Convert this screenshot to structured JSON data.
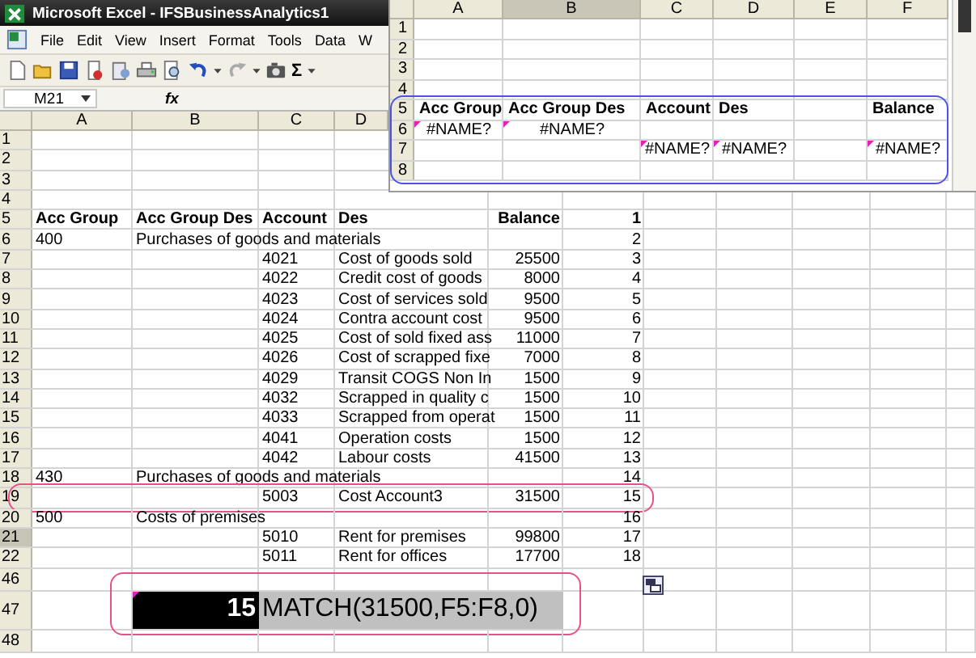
{
  "window": {
    "title": "Microsoft Excel - IFSBusinessAnalytics1"
  },
  "menu": [
    "File",
    "Edit",
    "View",
    "Insert",
    "Format",
    "Tools",
    "Data",
    "W"
  ],
  "toolbar": {
    "autosum": "Σ"
  },
  "formula_bar": {
    "name_box": "M21",
    "fx": "fx"
  },
  "sheet": {
    "columns": [
      "A",
      "B",
      "C",
      "D"
    ],
    "rows": [
      {
        "header": "1",
        "selected": false,
        "kind": "data",
        "circled": false,
        "cells": {}
      },
      {
        "header": "2",
        "selected": false,
        "kind": "data",
        "circled": false,
        "cells": {}
      },
      {
        "header": "3",
        "selected": false,
        "kind": "data",
        "circled": false,
        "cells": {}
      },
      {
        "header": "4",
        "selected": false,
        "kind": "data",
        "circled": false,
        "cells": {}
      },
      {
        "header": "5",
        "selected": false,
        "kind": "header",
        "circled": false,
        "cells": {
          "acc_group": "Acc Group",
          "acc_group_des": "Acc Group Des",
          "account": "Account",
          "des": "Des",
          "balance": "Balance",
          "column_6": "1"
        }
      },
      {
        "header": "6",
        "selected": false,
        "kind": "data",
        "circled": false,
        "cells": {
          "acc_group": "400",
          "acc_group_des": "Purchases of goods and materials",
          "column_6": "2"
        }
      },
      {
        "header": "7",
        "selected": false,
        "kind": "data",
        "circled": false,
        "cells": {
          "account": "4021",
          "des": "Cost of goods sold",
          "balance": "25500",
          "column_6": "3"
        }
      },
      {
        "header": "8",
        "selected": false,
        "kind": "data",
        "circled": false,
        "cells": {
          "account": "4022",
          "des": "Credit cost of goods",
          "balance": "8000",
          "column_6": "4"
        }
      },
      {
        "header": "9",
        "selected": false,
        "kind": "data",
        "circled": false,
        "cells": {
          "account": "4023",
          "des": "Cost of services sold",
          "balance": "9500",
          "column_6": "5"
        }
      },
      {
        "header": "10",
        "selected": false,
        "kind": "data",
        "circled": false,
        "cells": {
          "account": "4024",
          "des": "Contra account cost",
          "balance": "9500",
          "column_6": "6"
        }
      },
      {
        "header": "11",
        "selected": false,
        "kind": "data",
        "circled": false,
        "cells": {
          "account": "4025",
          "des": "Cost of sold fixed ass",
          "balance": "11000",
          "column_6": "7"
        }
      },
      {
        "header": "12",
        "selected": false,
        "kind": "data",
        "circled": false,
        "cells": {
          "account": "4026",
          "des": "Cost of scrapped fixe",
          "balance": "7000",
          "column_6": "8"
        }
      },
      {
        "header": "13",
        "selected": false,
        "kind": "data",
        "circled": false,
        "cells": {
          "account": "4029",
          "des": "Transit COGS Non In",
          "balance": "1500",
          "column_6": "9"
        }
      },
      {
        "header": "14",
        "selected": false,
        "kind": "data",
        "circled": false,
        "cells": {
          "account": "4032",
          "des": "Scrapped in quality c",
          "balance": "1500",
          "column_6": "10"
        }
      },
      {
        "header": "15",
        "selected": false,
        "kind": "data",
        "circled": false,
        "cells": {
          "account": "4033",
          "des": "Scrapped from operat",
          "balance": "1500",
          "column_6": "11"
        }
      },
      {
        "header": "16",
        "selected": false,
        "kind": "data",
        "circled": false,
        "cells": {
          "account": "4041",
          "des": "Operation costs",
          "balance": "1500",
          "column_6": "12"
        }
      },
      {
        "header": "17",
        "selected": false,
        "kind": "data",
        "circled": false,
        "cells": {
          "account": "4042",
          "des": "Labour costs",
          "balance": "41500",
          "column_6": "13"
        }
      },
      {
        "header": "18",
        "selected": false,
        "kind": "data",
        "circled": false,
        "cells": {
          "acc_group": "430",
          "acc_group_des": "Purchases of goods and materials",
          "column_6": "14"
        }
      },
      {
        "header": "19",
        "selected": false,
        "kind": "data",
        "circled": true,
        "cells": {
          "account": "5003",
          "des": "Cost Account3",
          "balance": "31500",
          "column_6": "15"
        }
      },
      {
        "header": "20",
        "selected": false,
        "kind": "data",
        "circled": false,
        "cells": {
          "acc_group": "500",
          "acc_group_des": "Costs of premises",
          "column_6": "16"
        }
      },
      {
        "header": "21",
        "selected": true,
        "kind": "data",
        "circled": false,
        "cells": {
          "account": "5010",
          "des": "Rent for premises",
          "balance": "99800",
          "column_6": "17"
        }
      },
      {
        "header": "22",
        "selected": false,
        "kind": "data",
        "circled": false,
        "cells": {
          "account": "5011",
          "des": "Rent for offices",
          "balance": "17700",
          "column_6": "18"
        }
      },
      {
        "header": "46",
        "selected": false,
        "kind": "spacer",
        "circled": false,
        "cells": {}
      },
      {
        "header": "47",
        "selected": false,
        "kind": "formula",
        "circled": true,
        "flagged": true,
        "cells": {
          "result": "15",
          "formula": "MATCH(31500,F5:F8,0)"
        }
      },
      {
        "header": "48",
        "selected": false,
        "kind": "spacer",
        "circled": false,
        "cells": {}
      }
    ]
  },
  "inset": {
    "framed": true,
    "columns": [
      {
        "label": "A",
        "selected": false
      },
      {
        "label": "B",
        "selected": true
      },
      {
        "label": "C",
        "selected": false
      },
      {
        "label": "D",
        "selected": false
      },
      {
        "label": "E",
        "selected": false
      },
      {
        "label": "F",
        "selected": false
      }
    ],
    "rows": [
      {
        "header": "1",
        "kind": "data",
        "cells": {}
      },
      {
        "header": "2",
        "kind": "data",
        "cells": {}
      },
      {
        "header": "3",
        "kind": "data",
        "cells": {}
      },
      {
        "header": "4",
        "kind": "data",
        "cells": {}
      },
      {
        "header": "5",
        "kind": "header",
        "cells": {
          "acc_group": {
            "text": "Acc Group",
            "flagged": false
          },
          "acc_group_des": {
            "text": "Acc Group Des",
            "flagged": false
          },
          "account": {
            "text": "Account",
            "flagged": false
          },
          "des": {
            "text": "Des",
            "flagged": false
          },
          "balance": {
            "text": "Balance",
            "flagged": false
          }
        }
      },
      {
        "header": "6",
        "kind": "data",
        "cells": {
          "acc_group": {
            "text": "#NAME?",
            "flagged": true
          },
          "acc_group_des": {
            "text": "#NAME?",
            "flagged": true
          }
        }
      },
      {
        "header": "7",
        "kind": "data",
        "cells": {
          "account": {
            "text": "#NAME?",
            "flagged": true
          },
          "des": {
            "text": "#NAME?",
            "flagged": true
          },
          "balance": {
            "text": "#NAME?",
            "flagged": true
          }
        }
      },
      {
        "header": "8",
        "kind": "data",
        "cells": {}
      }
    ]
  }
}
